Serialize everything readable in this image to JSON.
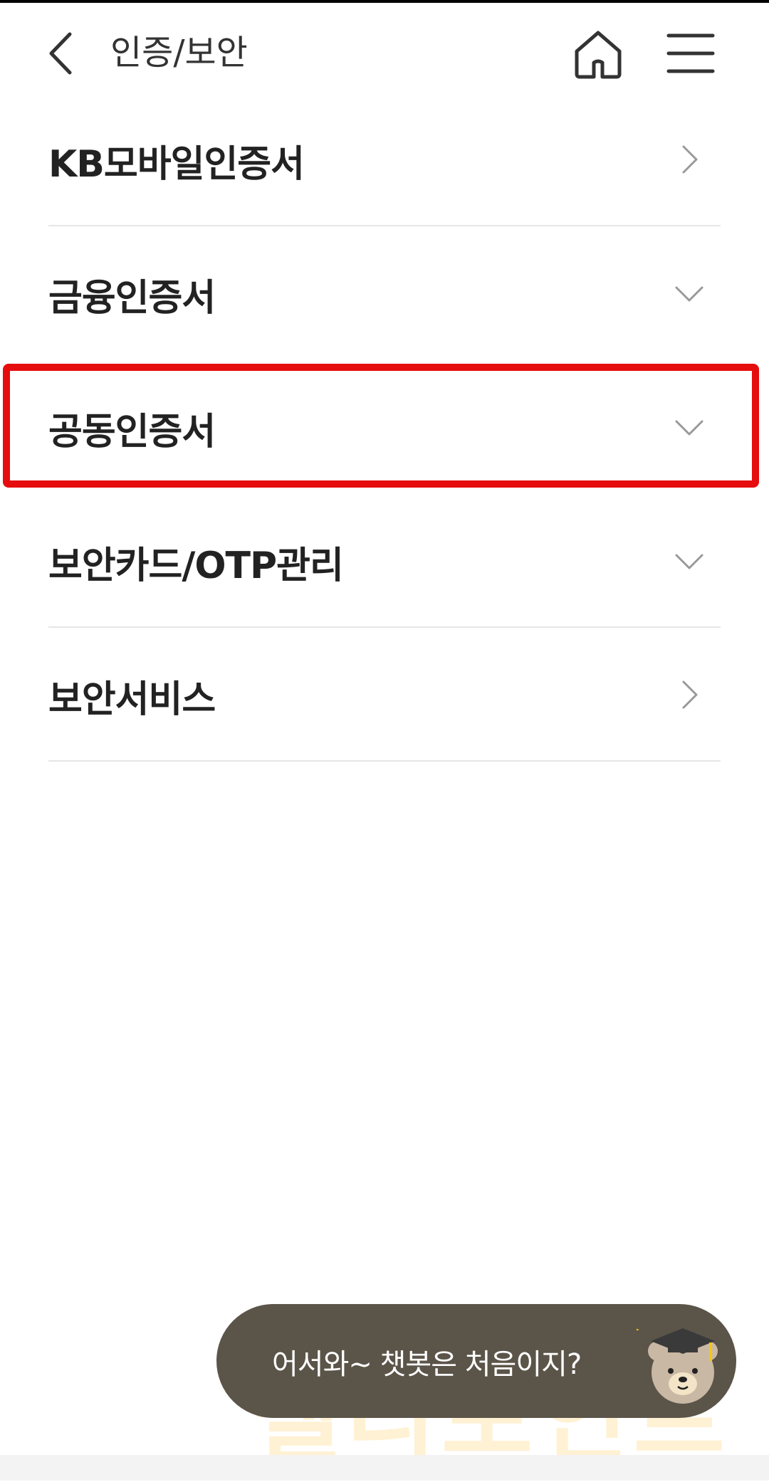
{
  "header": {
    "title": "인증/보안",
    "back_icon": "chevron-left-icon",
    "home_icon": "home-icon",
    "menu_icon": "hamburger-menu-icon"
  },
  "menu": {
    "items": [
      {
        "label": "KB모바일인증서",
        "icon": "chevron-right-icon"
      },
      {
        "label": "금융인증서",
        "icon": "chevron-down-icon"
      },
      {
        "label": "공동인증서",
        "icon": "chevron-down-icon"
      },
      {
        "label": "보안카드/OTP관리",
        "icon": "chevron-down-icon"
      },
      {
        "label": "보안서비스",
        "icon": "chevron-right-icon"
      }
    ]
  },
  "highlight": {
    "color": "#e50d0d",
    "target": "공동인증서"
  },
  "chatbot": {
    "message": "어서와~ 챗봇은 처음이지?",
    "bubble_color": "#5b5449",
    "avatar_icon": "bear-graduate-icon"
  },
  "watermark": {
    "text": "텔리포인트"
  }
}
